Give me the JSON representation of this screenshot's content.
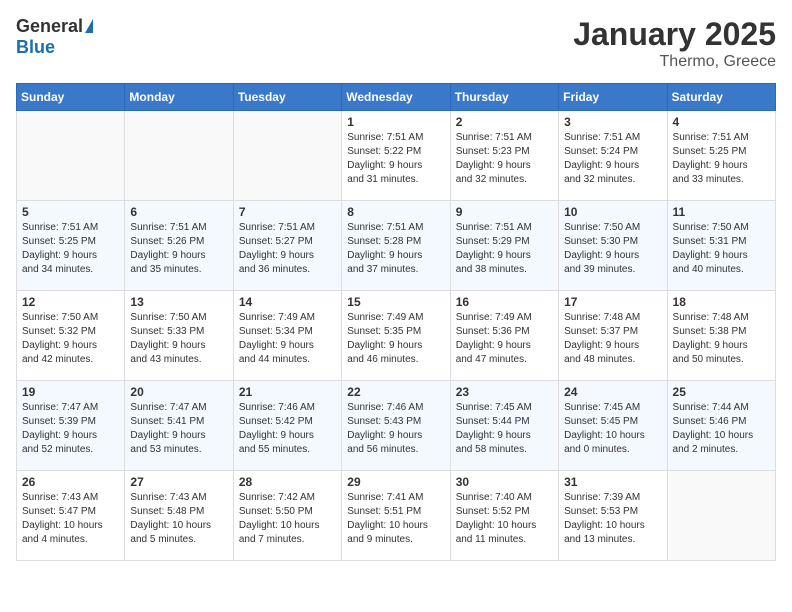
{
  "logo": {
    "general": "General",
    "blue": "Blue"
  },
  "title": "January 2025",
  "location": "Thermo, Greece",
  "weekdays": [
    "Sunday",
    "Monday",
    "Tuesday",
    "Wednesday",
    "Thursday",
    "Friday",
    "Saturday"
  ],
  "weeks": [
    [
      {
        "day": "",
        "info": ""
      },
      {
        "day": "",
        "info": ""
      },
      {
        "day": "",
        "info": ""
      },
      {
        "day": "1",
        "info": "Sunrise: 7:51 AM\nSunset: 5:22 PM\nDaylight: 9 hours\nand 31 minutes."
      },
      {
        "day": "2",
        "info": "Sunrise: 7:51 AM\nSunset: 5:23 PM\nDaylight: 9 hours\nand 32 minutes."
      },
      {
        "day": "3",
        "info": "Sunrise: 7:51 AM\nSunset: 5:24 PM\nDaylight: 9 hours\nand 32 minutes."
      },
      {
        "day": "4",
        "info": "Sunrise: 7:51 AM\nSunset: 5:25 PM\nDaylight: 9 hours\nand 33 minutes."
      }
    ],
    [
      {
        "day": "5",
        "info": "Sunrise: 7:51 AM\nSunset: 5:25 PM\nDaylight: 9 hours\nand 34 minutes."
      },
      {
        "day": "6",
        "info": "Sunrise: 7:51 AM\nSunset: 5:26 PM\nDaylight: 9 hours\nand 35 minutes."
      },
      {
        "day": "7",
        "info": "Sunrise: 7:51 AM\nSunset: 5:27 PM\nDaylight: 9 hours\nand 36 minutes."
      },
      {
        "day": "8",
        "info": "Sunrise: 7:51 AM\nSunset: 5:28 PM\nDaylight: 9 hours\nand 37 minutes."
      },
      {
        "day": "9",
        "info": "Sunrise: 7:51 AM\nSunset: 5:29 PM\nDaylight: 9 hours\nand 38 minutes."
      },
      {
        "day": "10",
        "info": "Sunrise: 7:50 AM\nSunset: 5:30 PM\nDaylight: 9 hours\nand 39 minutes."
      },
      {
        "day": "11",
        "info": "Sunrise: 7:50 AM\nSunset: 5:31 PM\nDaylight: 9 hours\nand 40 minutes."
      }
    ],
    [
      {
        "day": "12",
        "info": "Sunrise: 7:50 AM\nSunset: 5:32 PM\nDaylight: 9 hours\nand 42 minutes."
      },
      {
        "day": "13",
        "info": "Sunrise: 7:50 AM\nSunset: 5:33 PM\nDaylight: 9 hours\nand 43 minutes."
      },
      {
        "day": "14",
        "info": "Sunrise: 7:49 AM\nSunset: 5:34 PM\nDaylight: 9 hours\nand 44 minutes."
      },
      {
        "day": "15",
        "info": "Sunrise: 7:49 AM\nSunset: 5:35 PM\nDaylight: 9 hours\nand 46 minutes."
      },
      {
        "day": "16",
        "info": "Sunrise: 7:49 AM\nSunset: 5:36 PM\nDaylight: 9 hours\nand 47 minutes."
      },
      {
        "day": "17",
        "info": "Sunrise: 7:48 AM\nSunset: 5:37 PM\nDaylight: 9 hours\nand 48 minutes."
      },
      {
        "day": "18",
        "info": "Sunrise: 7:48 AM\nSunset: 5:38 PM\nDaylight: 9 hours\nand 50 minutes."
      }
    ],
    [
      {
        "day": "19",
        "info": "Sunrise: 7:47 AM\nSunset: 5:39 PM\nDaylight: 9 hours\nand 52 minutes."
      },
      {
        "day": "20",
        "info": "Sunrise: 7:47 AM\nSunset: 5:41 PM\nDaylight: 9 hours\nand 53 minutes."
      },
      {
        "day": "21",
        "info": "Sunrise: 7:46 AM\nSunset: 5:42 PM\nDaylight: 9 hours\nand 55 minutes."
      },
      {
        "day": "22",
        "info": "Sunrise: 7:46 AM\nSunset: 5:43 PM\nDaylight: 9 hours\nand 56 minutes."
      },
      {
        "day": "23",
        "info": "Sunrise: 7:45 AM\nSunset: 5:44 PM\nDaylight: 9 hours\nand 58 minutes."
      },
      {
        "day": "24",
        "info": "Sunrise: 7:45 AM\nSunset: 5:45 PM\nDaylight: 10 hours\nand 0 minutes."
      },
      {
        "day": "25",
        "info": "Sunrise: 7:44 AM\nSunset: 5:46 PM\nDaylight: 10 hours\nand 2 minutes."
      }
    ],
    [
      {
        "day": "26",
        "info": "Sunrise: 7:43 AM\nSunset: 5:47 PM\nDaylight: 10 hours\nand 4 minutes."
      },
      {
        "day": "27",
        "info": "Sunrise: 7:43 AM\nSunset: 5:48 PM\nDaylight: 10 hours\nand 5 minutes."
      },
      {
        "day": "28",
        "info": "Sunrise: 7:42 AM\nSunset: 5:50 PM\nDaylight: 10 hours\nand 7 minutes."
      },
      {
        "day": "29",
        "info": "Sunrise: 7:41 AM\nSunset: 5:51 PM\nDaylight: 10 hours\nand 9 minutes."
      },
      {
        "day": "30",
        "info": "Sunrise: 7:40 AM\nSunset: 5:52 PM\nDaylight: 10 hours\nand 11 minutes."
      },
      {
        "day": "31",
        "info": "Sunrise: 7:39 AM\nSunset: 5:53 PM\nDaylight: 10 hours\nand 13 minutes."
      },
      {
        "day": "",
        "info": ""
      }
    ]
  ]
}
